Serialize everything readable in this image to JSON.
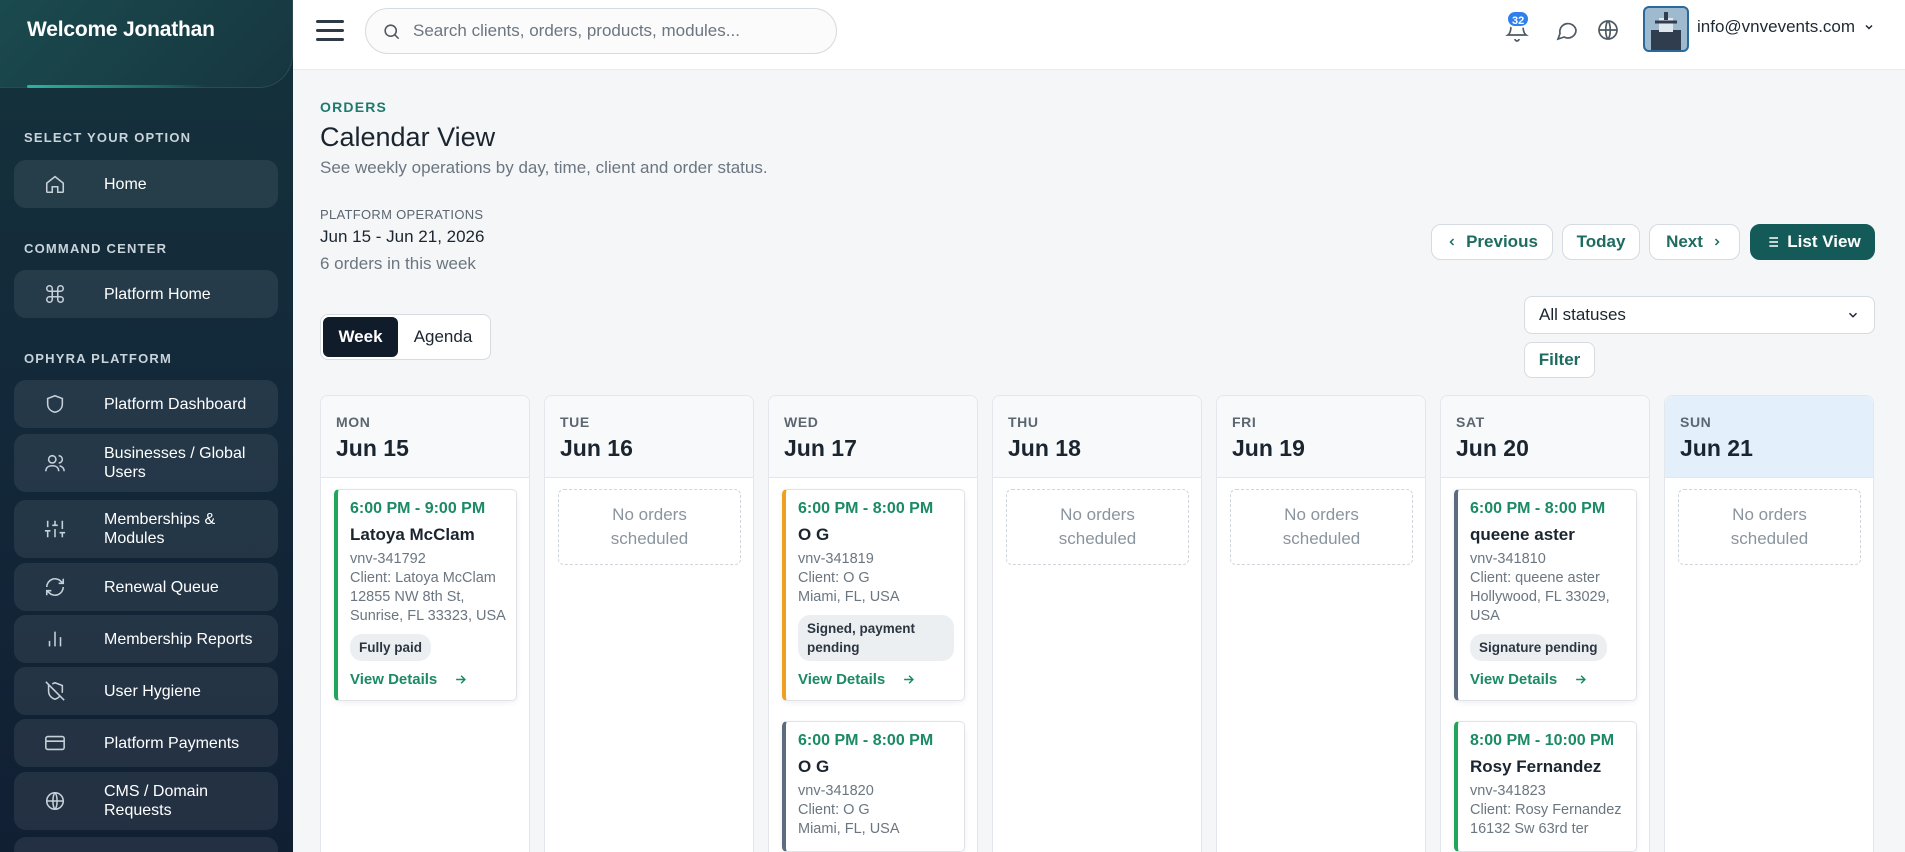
{
  "sidebar": {
    "welcome": "Welcome Jonathan",
    "sections": [
      {
        "title": "SELECT YOUR OPTION",
        "items": [
          {
            "label": "Home",
            "icon": "home-icon"
          }
        ]
      },
      {
        "title": "COMMAND CENTER",
        "items": [
          {
            "label": "Platform Home",
            "icon": "command-icon"
          }
        ]
      },
      {
        "title": "OPHYRA PLATFORM",
        "items": [
          {
            "label": "Platform Dashboard",
            "icon": "shield-icon"
          },
          {
            "label": "Businesses / Global Users",
            "icon": "users-icon"
          },
          {
            "label": "Memberships & Modules",
            "icon": "sliders-icon"
          },
          {
            "label": "Renewal Queue",
            "icon": "refresh-icon"
          },
          {
            "label": "Membership Reports",
            "icon": "bar-chart-icon"
          },
          {
            "label": "User Hygiene",
            "icon": "shield-off-icon"
          },
          {
            "label": "Platform Payments",
            "icon": "credit-card-icon"
          },
          {
            "label": "CMS / Domain Requests",
            "icon": "globe-icon"
          }
        ]
      }
    ]
  },
  "topbar": {
    "search_placeholder": "Search clients, orders, products, modules...",
    "notification_count": "32",
    "account_email": "info@vnvevents.com"
  },
  "page": {
    "eyebrow": "ORDERS",
    "title": "Calendar View",
    "subtitle": "See weekly operations by day, time, client and order status.",
    "ops_label": "PLATFORM OPERATIONS",
    "date_range": "Jun 15 - Jun 21, 2026",
    "order_count_text": "6 orders in this week"
  },
  "controls": {
    "previous": "Previous",
    "today": "Today",
    "next": "Next",
    "list_view": "List View",
    "view_week": "Week",
    "view_agenda": "Agenda",
    "status_select": "All statuses",
    "filter": "Filter"
  },
  "calendar": {
    "empty_text": "No orders scheduled",
    "view_details": "View Details",
    "days": [
      {
        "dow": "MON",
        "date": "Jun 15",
        "orders": [
          {
            "time": "6:00 PM - 9:00 PM",
            "name": "Latoya McClam",
            "number": "vnv-341792",
            "client": "Client: Latoya McClam",
            "address": "12855 NW 8th St, Sunrise, FL 33323, USA",
            "status": "Fully paid",
            "accent": "#20a55a"
          }
        ]
      },
      {
        "dow": "TUE",
        "date": "Jun 16",
        "orders": []
      },
      {
        "dow": "WED",
        "date": "Jun 17",
        "orders": [
          {
            "time": "6:00 PM - 8:00 PM",
            "name": "O G",
            "number": "vnv-341819",
            "client": "Client: O G",
            "address": "Miami, FL, USA",
            "status": "Signed, payment pending",
            "accent": "#f0a020"
          },
          {
            "time": "6:00 PM - 8:00 PM",
            "name": "O G",
            "number": "vnv-341820",
            "client": "Client: O G",
            "address": "Miami, FL, USA",
            "status": "",
            "accent": "#5b6b80"
          }
        ]
      },
      {
        "dow": "THU",
        "date": "Jun 18",
        "orders": []
      },
      {
        "dow": "FRI",
        "date": "Jun 19",
        "orders": []
      },
      {
        "dow": "SAT",
        "date": "Jun 20",
        "orders": [
          {
            "time": "6:00 PM - 8:00 PM",
            "name": "queene aster",
            "number": "vnv-341810",
            "client": "Client: queene aster",
            "address": "Hollywood, FL 33029, USA",
            "status": "Signature pending",
            "accent": "#5b6b80"
          },
          {
            "time": "8:00 PM - 10:00 PM",
            "name": "Rosy Fernandez",
            "number": "vnv-341823",
            "client": "Client: Rosy Fernandez",
            "address": "16132 Sw 63rd ter",
            "status": "",
            "accent": "#20a55a"
          }
        ]
      },
      {
        "dow": "SUN",
        "date": "Jun 21",
        "orders": []
      }
    ]
  }
}
